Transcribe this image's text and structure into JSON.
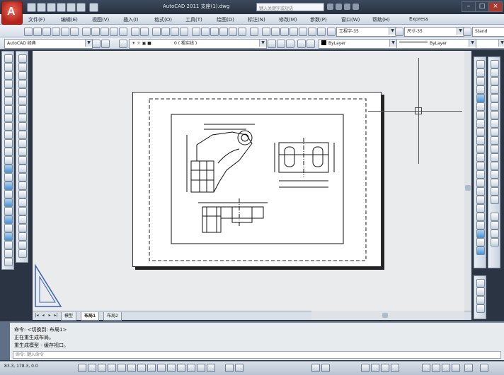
{
  "title_bar": {
    "app_title": "AutoCAD 2011  支座(1).dwg",
    "search_placeholder": "键入关键字或短语",
    "window_controls": [
      "minimize",
      "maximize",
      "close"
    ]
  },
  "menu": {
    "items": [
      "文件(F)",
      "编辑(E)",
      "视图(V)",
      "插入(I)",
      "格式(O)",
      "工具(T)",
      "绘图(D)",
      "标注(N)",
      "修改(M)",
      "参数(P)",
      "窗口(W)",
      "帮助(H)",
      "Express"
    ]
  },
  "toolbar1": {
    "text_style": "工程字-35",
    "dim_style": "尺寸-35",
    "third_style": "Stand"
  },
  "toolbar2": {
    "workspace": "AutoCAD 经典",
    "layer": "0 ( 粗实线 )",
    "color": "ByLayer",
    "linetype": "ByLayer"
  },
  "tabs": {
    "items": [
      "模型",
      "布局1",
      "布局2"
    ],
    "active_index": 1
  },
  "command": {
    "lines": [
      "命令:     <切换到: 布局1>",
      "正在重生成布局。",
      "重生成模型 - 缓存视口。"
    ],
    "input_placeholder": "命令: 键入命令"
  },
  "status": {
    "coords": "83.3, 178.3, 0.0"
  },
  "colors": {
    "app_red": "#c0281c",
    "frame_dark": "#2b3442",
    "canvas": "#e9ebec"
  }
}
